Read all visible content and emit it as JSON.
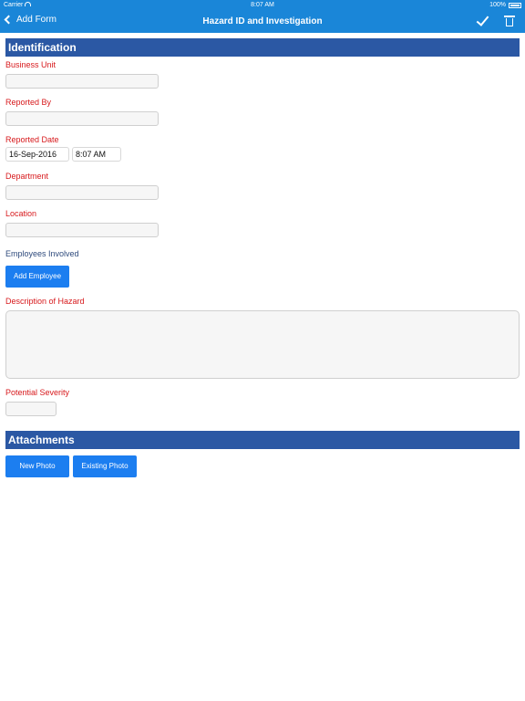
{
  "status_bar": {
    "carrier": "Carrier",
    "time": "8:07 AM",
    "battery": "100%"
  },
  "nav": {
    "back_label": "Add Form",
    "title": "Hazard ID and Investigation"
  },
  "sections": {
    "identification": "Identification",
    "attachments": "Attachments"
  },
  "fields": {
    "business_unit": {
      "label": "Business Unit",
      "value": ""
    },
    "reported_by": {
      "label": "Reported By",
      "value": ""
    },
    "reported_date": {
      "label": "Reported Date",
      "date": "16-Sep-2016",
      "time": "8:07 AM"
    },
    "department": {
      "label": "Department",
      "value": ""
    },
    "location": {
      "label": "Location",
      "value": ""
    },
    "employees_involved": {
      "label": "Employees Involved",
      "button": "Add Employee"
    },
    "description": {
      "label": "Description of Hazard",
      "value": ""
    },
    "potential_severity": {
      "label": "Potential Severity",
      "value": ""
    }
  },
  "attachments": {
    "new_photo": "New Photo",
    "existing_photo": "Existing Photo"
  },
  "colors": {
    "nav_bar": "#1a86d8",
    "section_header": "#2b58a4",
    "required_label": "#d7191c",
    "button": "#1c7ef0"
  }
}
